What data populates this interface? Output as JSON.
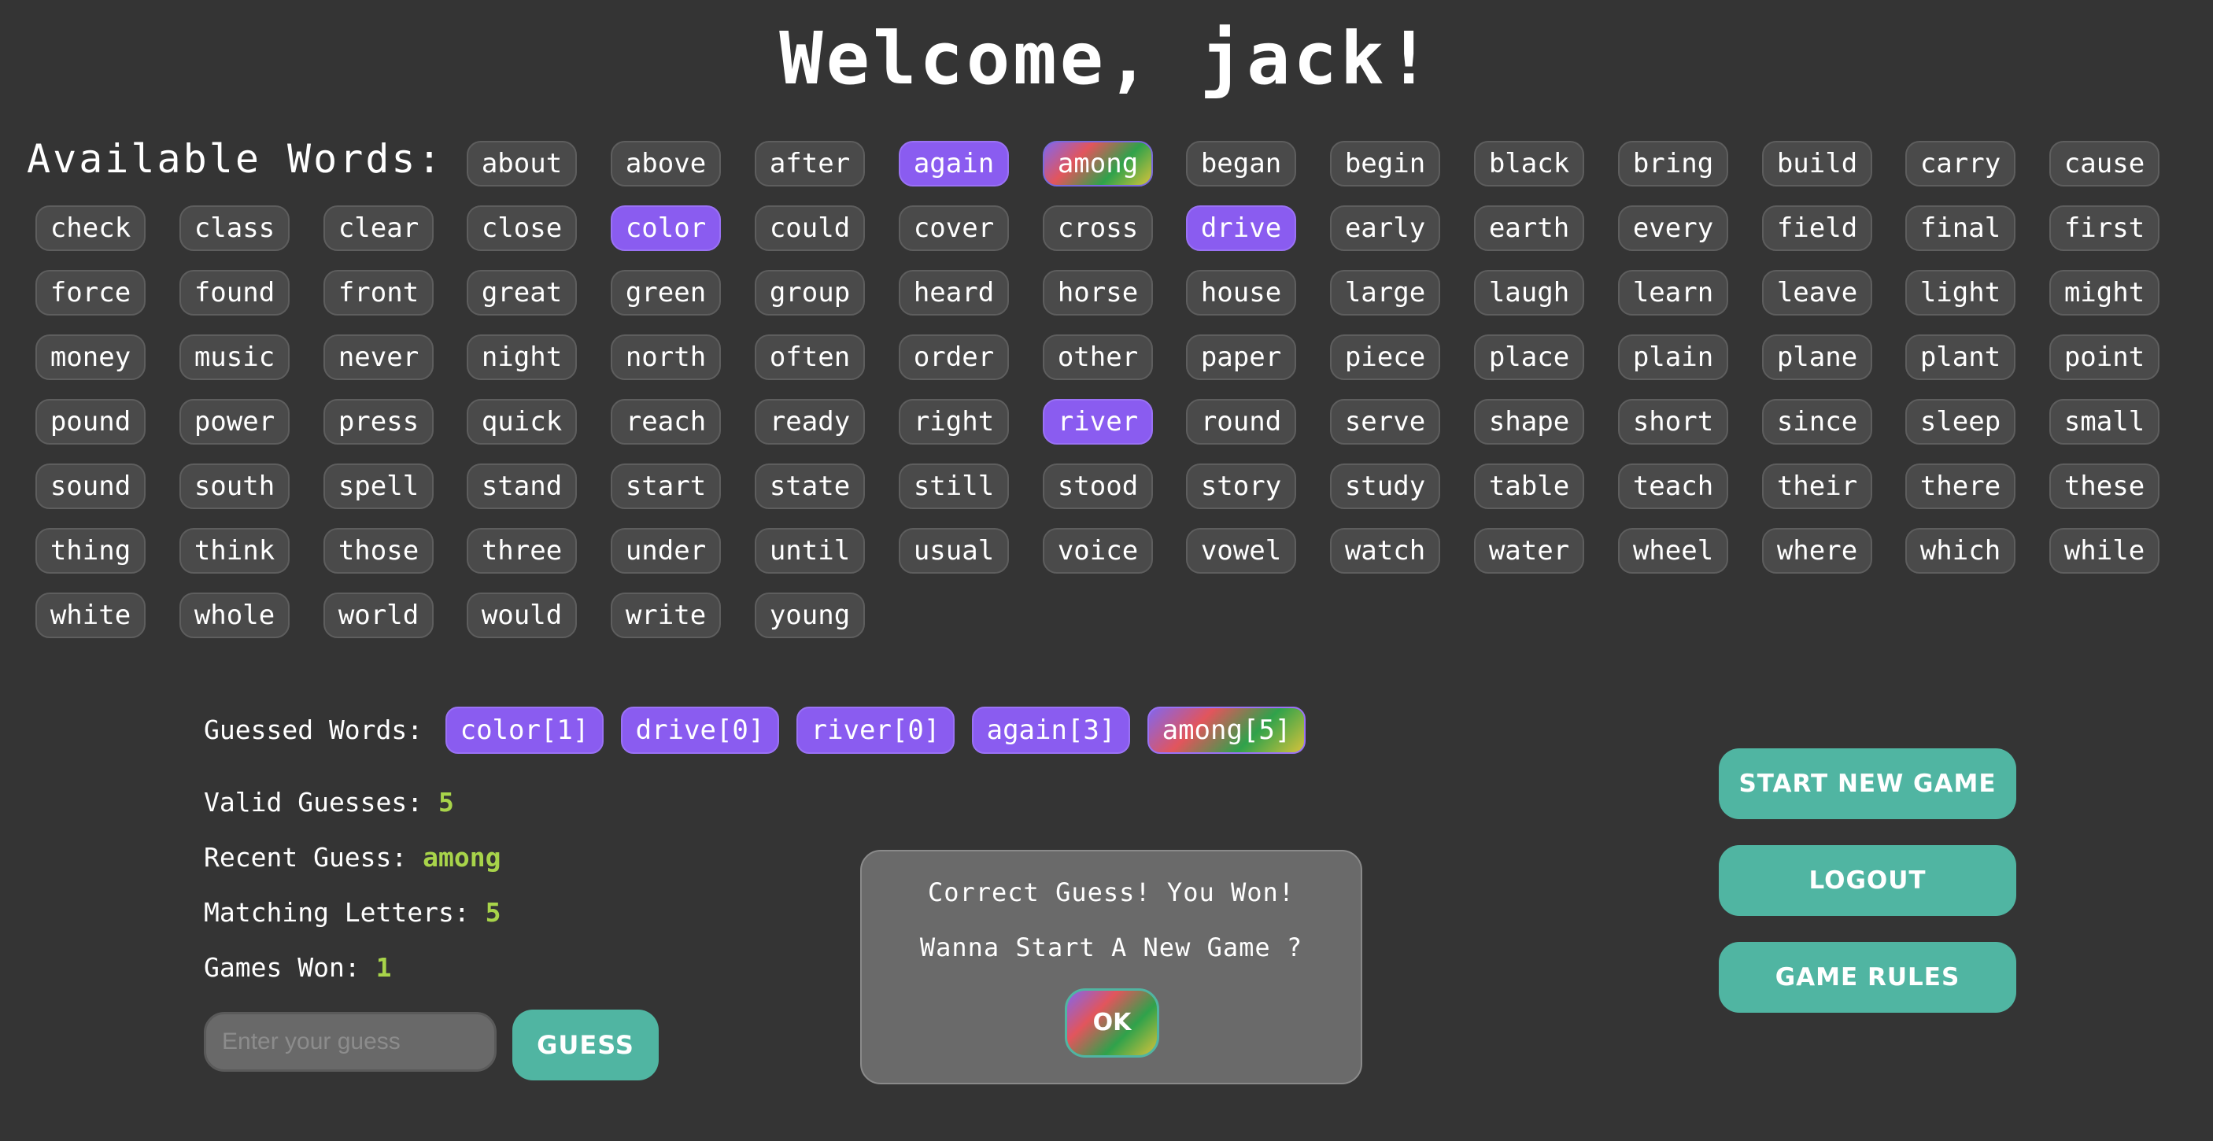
{
  "header": {
    "title": "Welcome, jack!"
  },
  "available": {
    "label": "Available Words:",
    "words": [
      "about",
      "above",
      "after",
      "again",
      "among",
      "began",
      "begin",
      "black",
      "bring",
      "build",
      "carry",
      "cause",
      "check",
      "class",
      "clear",
      "close",
      "color",
      "could",
      "cover",
      "cross",
      "drive",
      "early",
      "earth",
      "every",
      "field",
      "final",
      "first",
      "force",
      "found",
      "front",
      "great",
      "green",
      "group",
      "heard",
      "horse",
      "house",
      "large",
      "laugh",
      "learn",
      "leave",
      "light",
      "might",
      "money",
      "music",
      "never",
      "night",
      "north",
      "often",
      "order",
      "other",
      "paper",
      "piece",
      "place",
      "plain",
      "plane",
      "plant",
      "point",
      "pound",
      "power",
      "press",
      "quick",
      "reach",
      "ready",
      "right",
      "river",
      "round",
      "serve",
      "shape",
      "short",
      "since",
      "sleep",
      "small",
      "sound",
      "south",
      "spell",
      "stand",
      "start",
      "state",
      "still",
      "stood",
      "story",
      "study",
      "table",
      "teach",
      "their",
      "there",
      "these",
      "thing",
      "think",
      "those",
      "three",
      "under",
      "until",
      "usual",
      "voice",
      "vowel",
      "watch",
      "water",
      "wheel",
      "where",
      "which",
      "while",
      "white",
      "whole",
      "world",
      "would",
      "write",
      "young"
    ],
    "guessed": [
      "again",
      "color",
      "drive",
      "river"
    ],
    "winning": "among"
  },
  "guessed_words": {
    "label": "Guessed Words:",
    "items": [
      "color[1]",
      "drive[0]",
      "river[0]",
      "again[3]",
      "among[5]"
    ]
  },
  "stats": {
    "valid_label": "Valid Guesses:",
    "valid_value": "5",
    "recent_label": "Recent Guess:",
    "recent_value": "among",
    "matching_label": "Matching Letters:",
    "matching_value": "5",
    "won_label": "Games Won:",
    "won_value": "1"
  },
  "guess_form": {
    "placeholder": "Enter your guess",
    "button": "GUESS"
  },
  "modal": {
    "line1": "Correct Guess! You Won!",
    "line2": "Wanna Start A New Game ?",
    "ok": "OK"
  },
  "actions": {
    "new_game": "START NEW GAME",
    "logout": "LOGOUT",
    "rules": "GAME RULES"
  },
  "colors": {
    "background": "#343434",
    "guessed": "#8a5cf0",
    "accent": "#50b5a2",
    "value": "#a8d44a"
  }
}
